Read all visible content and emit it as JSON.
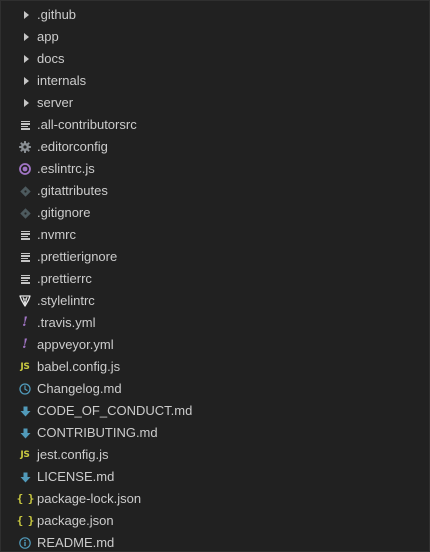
{
  "explorer": {
    "items": [
      {
        "label": ".github",
        "icon": "chevron-right-icon"
      },
      {
        "label": "app",
        "icon": "chevron-right-icon"
      },
      {
        "label": "docs",
        "icon": "chevron-right-icon"
      },
      {
        "label": "internals",
        "icon": "chevron-right-icon"
      },
      {
        "label": "server",
        "icon": "chevron-right-icon"
      },
      {
        "label": ".all-contributorsrc",
        "icon": "text-lines-icon"
      },
      {
        "label": ".editorconfig",
        "icon": "gear-icon"
      },
      {
        "label": ".eslintrc.js",
        "icon": "eslint-icon"
      },
      {
        "label": ".gitattributes",
        "icon": "git-icon"
      },
      {
        "label": ".gitignore",
        "icon": "git-icon"
      },
      {
        "label": ".nvmrc",
        "icon": "text-lines-icon"
      },
      {
        "label": ".prettierignore",
        "icon": "text-lines-icon"
      },
      {
        "label": ".prettierrc",
        "icon": "text-lines-icon"
      },
      {
        "label": ".stylelintrc",
        "icon": "stylelint-icon"
      },
      {
        "label": ".travis.yml",
        "icon": "yaml-icon"
      },
      {
        "label": "appveyor.yml",
        "icon": "yaml-icon"
      },
      {
        "label": "babel.config.js",
        "icon": "javascript-icon"
      },
      {
        "label": "Changelog.md",
        "icon": "clock-icon"
      },
      {
        "label": "CODE_OF_CONDUCT.md",
        "icon": "markdown-arrow-icon"
      },
      {
        "label": "CONTRIBUTING.md",
        "icon": "markdown-arrow-icon"
      },
      {
        "label": "jest.config.js",
        "icon": "javascript-icon"
      },
      {
        "label": "LICENSE.md",
        "icon": "markdown-arrow-icon"
      },
      {
        "label": "package-lock.json",
        "icon": "json-icon"
      },
      {
        "label": "package.json",
        "icon": "json-icon"
      },
      {
        "label": "README.md",
        "icon": "info-icon"
      }
    ],
    "icon_text": {
      "javascript": "JS",
      "json": "{ }",
      "yaml": "!"
    },
    "colors": {
      "background": "#212121",
      "text": "#cccccc",
      "folder_chevron": "#c5c5c5",
      "gear": "#8a8f94",
      "eslint": "#a074c4",
      "git": "#4d5a5e",
      "stylelint": "#e8e8e8",
      "yaml": "#a074c4",
      "javascript": "#cbcb41",
      "json": "#cbcb41",
      "markdown": "#519aba",
      "changelog": "#519aba",
      "readme": "#519aba"
    }
  }
}
